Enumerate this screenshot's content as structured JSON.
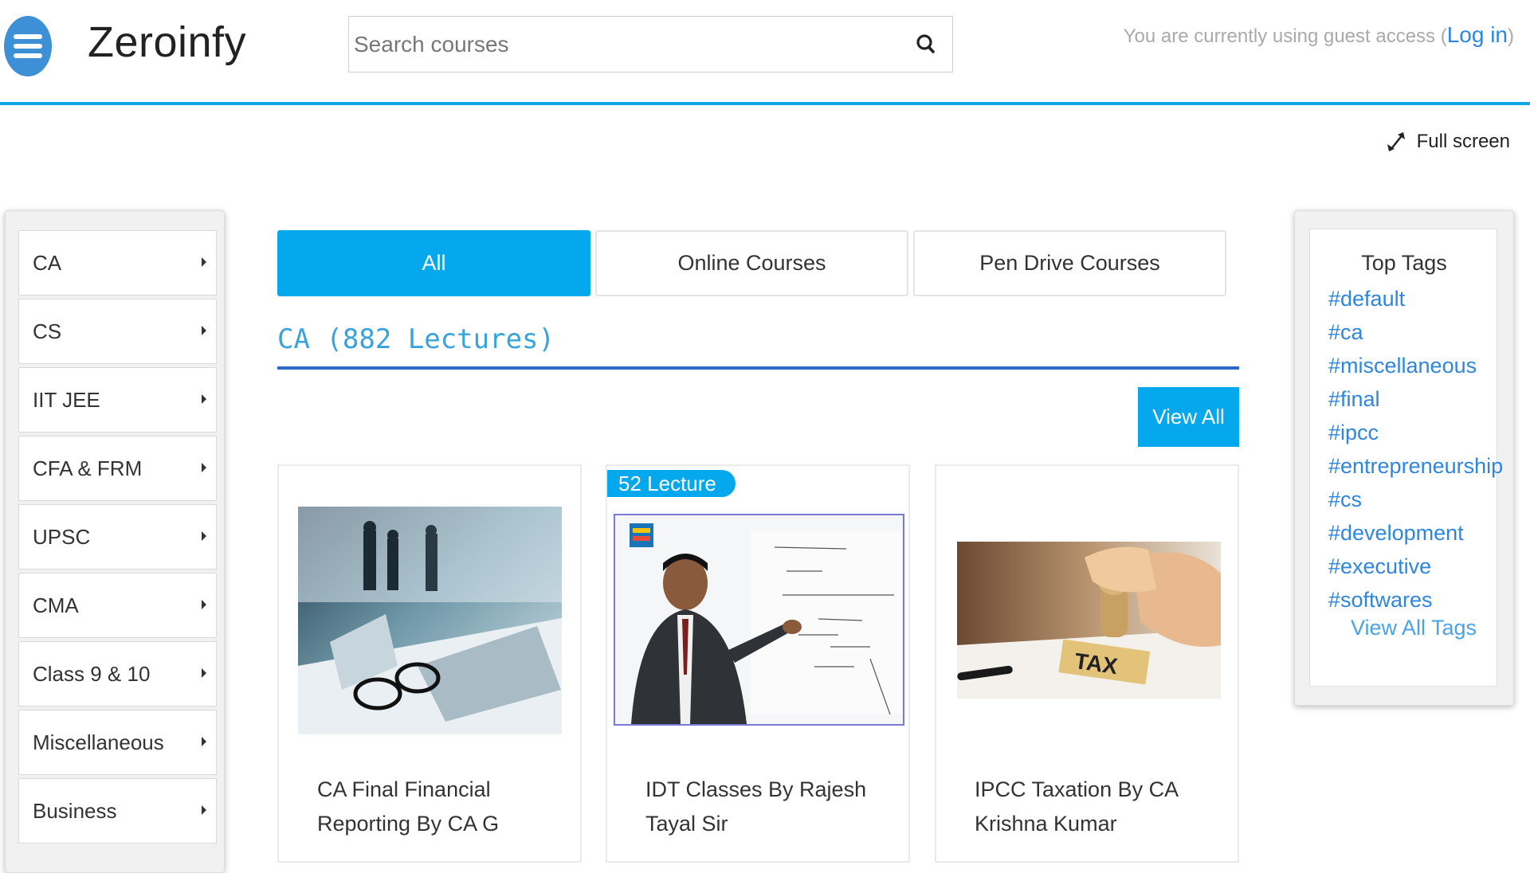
{
  "header": {
    "brand": "Zeroinfy",
    "search_placeholder": "Search courses",
    "guest_text": "You are currently using guest access (",
    "login_label": "Log in",
    "guest_close": ")",
    "fullscreen_label": "Full screen"
  },
  "sidebar": {
    "items": [
      {
        "label": "CA"
      },
      {
        "label": "CS"
      },
      {
        "label": "IIT JEE"
      },
      {
        "label": "CFA & FRM"
      },
      {
        "label": "UPSC"
      },
      {
        "label": "CMA"
      },
      {
        "label": "Class 9 & 10"
      },
      {
        "label": "Miscellaneous"
      },
      {
        "label": "Business"
      }
    ]
  },
  "tabs": [
    {
      "label": "All",
      "active": true
    },
    {
      "label": "Online Courses",
      "active": false
    },
    {
      "label": "Pen Drive Courses",
      "active": false
    }
  ],
  "section": {
    "title": "CA (882 Lectures)",
    "view_all_label": "View All"
  },
  "courses": [
    {
      "title": "CA Final Financial Reporting By CA G",
      "badge": ""
    },
    {
      "title": "IDT Classes By Rajesh Tayal Sir",
      "badge": "52 Lecture"
    },
    {
      "title": "IPCC Taxation By CA Krishna Kumar",
      "badge": ""
    }
  ],
  "tags_panel": {
    "title": "Top Tags",
    "tags": [
      "#default",
      "#ca",
      "#miscellaneous",
      "#final",
      "#ipcc",
      "#entrepreneurship",
      "#cs",
      "#development",
      "#executive",
      "#softwares"
    ],
    "view_all_label": "View All Tags"
  },
  "colors": {
    "accent": "#05a8ec",
    "link": "#2e86de",
    "header_rule": "#0ea5e9",
    "section_rule": "#2f69c6"
  }
}
